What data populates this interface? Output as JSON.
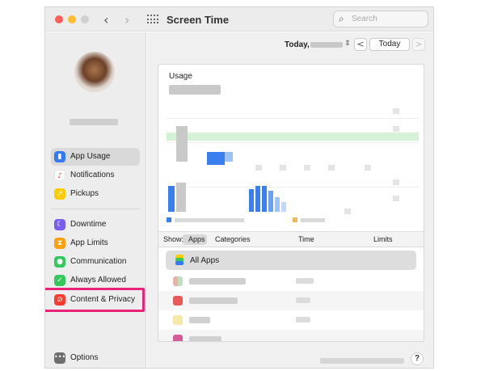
{
  "window": {
    "title": "Screen Time",
    "search_placeholder": "Search",
    "nav_back": "‹",
    "nav_forward": "›"
  },
  "sidebar": {
    "items": [
      {
        "label": "App Usage",
        "icon": "bar-chart-icon",
        "color": "#3478f6",
        "selected": true
      },
      {
        "label": "Notifications",
        "icon": "bell-icon",
        "color": "#ff3b30",
        "selected": false
      },
      {
        "label": "Pickups",
        "icon": "pickup-icon",
        "color": "#ffcc00",
        "selected": false
      },
      {
        "label": "Downtime",
        "icon": "moon-icon",
        "color": "#7a5cf0",
        "selected": false
      },
      {
        "label": "App Limits",
        "icon": "hourglass-icon",
        "color": "#ff9f0a",
        "selected": false
      },
      {
        "label": "Communication",
        "icon": "person-icon",
        "color": "#34c759",
        "selected": false
      },
      {
        "label": "Always Allowed",
        "icon": "checkmark-icon",
        "color": "#34c759",
        "selected": false
      },
      {
        "label": "Content & Privacy",
        "icon": "no-entry-icon",
        "color": "#ff3b30",
        "selected": false
      }
    ],
    "options_label": "Options",
    "highlight_color": "#e9237a"
  },
  "toolbar": {
    "date_label": "Today,",
    "prev": "<",
    "today_button": "Today",
    "next": ">"
  },
  "usage": {
    "label": "Usage"
  },
  "showbar": {
    "show_label": "Show:",
    "apps_tab": "Apps",
    "categories_tab": "Categories",
    "time_col": "Time",
    "limits_col": "Limits"
  },
  "list": {
    "all_apps_label": "All Apps"
  },
  "help": "?"
}
